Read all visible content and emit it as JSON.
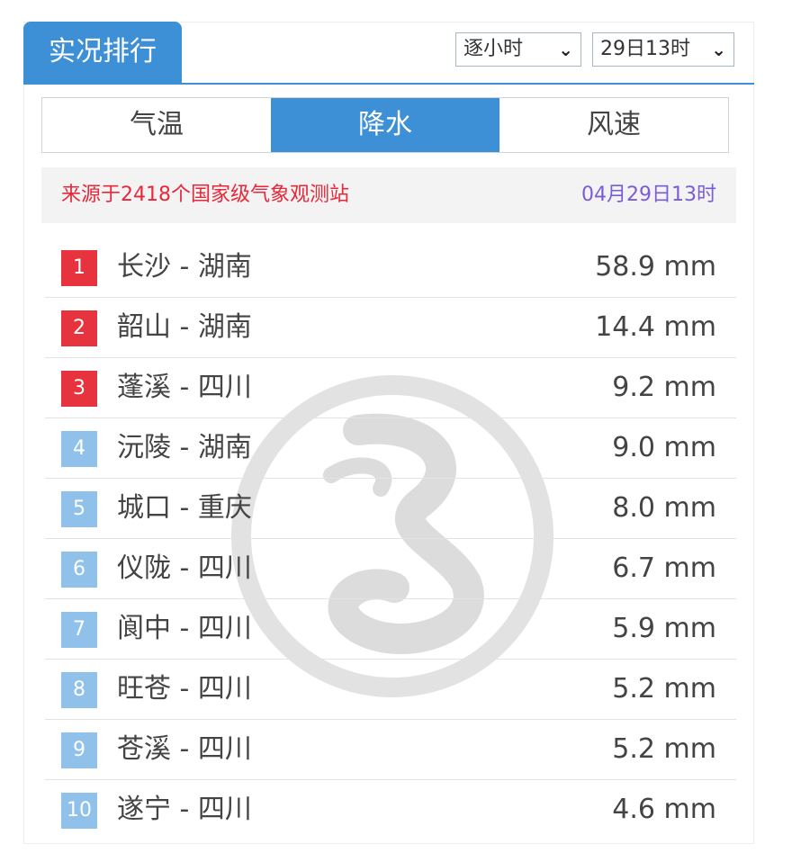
{
  "header": {
    "title": "实况排行"
  },
  "selectors": {
    "interval": {
      "value": "逐小时"
    },
    "datetime": {
      "value": "29日13时"
    }
  },
  "tabs": [
    {
      "label": "气温",
      "active": false
    },
    {
      "label": "降水",
      "active": true
    },
    {
      "label": "风速",
      "active": false
    }
  ],
  "info": {
    "source": "来源于2418个国家级气象观测站",
    "time": "04月29日13时"
  },
  "rankings": [
    {
      "rank": "1",
      "station": "长沙 - 湖南",
      "value": "58.9 mm"
    },
    {
      "rank": "2",
      "station": "韶山 - 湖南",
      "value": "14.4 mm"
    },
    {
      "rank": "3",
      "station": "蓬溪 - 四川",
      "value": "9.2 mm"
    },
    {
      "rank": "4",
      "station": "沅陵 - 湖南",
      "value": "9.0 mm"
    },
    {
      "rank": "5",
      "station": "城口 - 重庆",
      "value": "8.0 mm"
    },
    {
      "rank": "6",
      "station": "仪陇 - 四川",
      "value": "6.7 mm"
    },
    {
      "rank": "7",
      "station": "阆中 - 四川",
      "value": "5.9 mm"
    },
    {
      "rank": "8",
      "station": "旺苍 - 四川",
      "value": "5.2 mm"
    },
    {
      "rank": "9",
      "station": "苍溪 - 四川",
      "value": "5.2 mm"
    },
    {
      "rank": "10",
      "station": "遂宁 - 四川",
      "value": "4.6 mm"
    }
  ],
  "colors": {
    "accent": "#3d8fd6",
    "top_rank": "#e6333d",
    "other_rank": "#8fc1ea",
    "source_text": "#e8283a",
    "time_text": "#7a5cd6"
  },
  "icons": {
    "dropdown": "chevron-down-icon",
    "watermark": "dragon-logo-watermark"
  }
}
